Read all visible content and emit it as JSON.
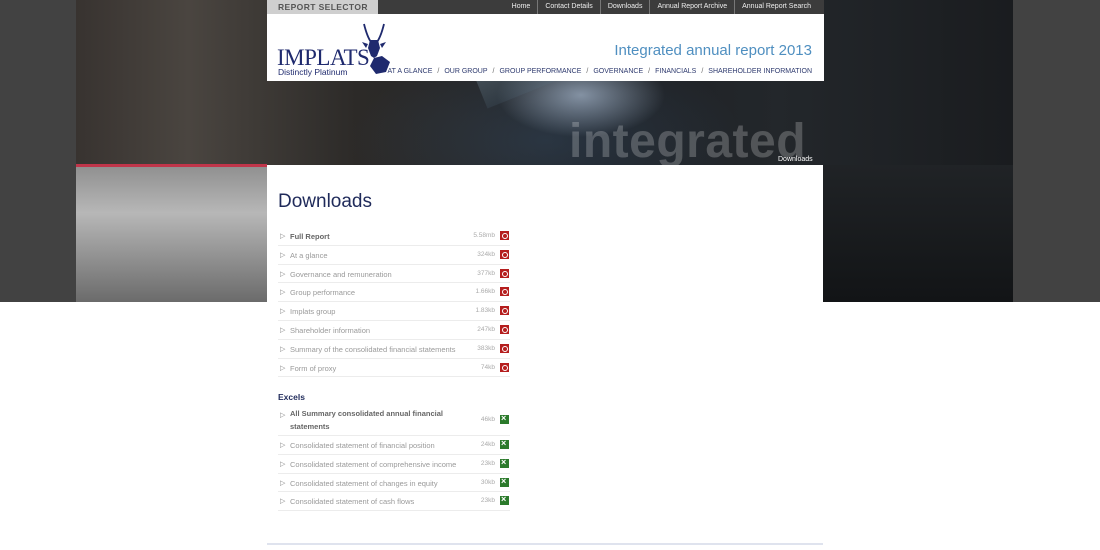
{
  "top_bar": {
    "report_selector": "REPORT SELECTOR",
    "links": [
      "Home",
      "Contact Details",
      "Downloads",
      "Annual Report Archive",
      "Annual Report Search"
    ]
  },
  "header": {
    "logo_word": "IMPLATS",
    "logo_tagline": "Distinctly Platinum",
    "site_title": "Integrated annual report 2013",
    "nav": [
      "AT A GLANCE",
      "OUR GROUP",
      "GROUP PERFORMANCE",
      "GOVERNANCE",
      "FINANCIALS",
      "SHAREHOLDER INFORMATION"
    ],
    "nav_separator": "/"
  },
  "hero": {
    "word": "integrated",
    "breadcrumb": "Downloads"
  },
  "page": {
    "title": "Downloads"
  },
  "pdf_downloads": [
    {
      "label": "Full Report",
      "size": "5.58mb",
      "icon": "pdf-icon",
      "bold": true
    },
    {
      "label": "At a glance",
      "size": "324kb",
      "icon": "pdf-icon",
      "bold": false
    },
    {
      "label": "Governance and remuneration",
      "size": "377kb",
      "icon": "pdf-icon",
      "bold": false
    },
    {
      "label": "Group performance",
      "size": "1.66kb",
      "icon": "pdf-icon",
      "bold": false
    },
    {
      "label": "Implats group",
      "size": "1.83kb",
      "icon": "pdf-icon",
      "bold": false
    },
    {
      "label": "Shareholder information",
      "size": "247kb",
      "icon": "pdf-icon",
      "bold": false
    },
    {
      "label": "Summary of the consolidated financial statements",
      "size": "383kb",
      "icon": "pdf-icon",
      "bold": false
    },
    {
      "label": "Form of proxy",
      "size": "74kb",
      "icon": "pdf-icon",
      "bold": false
    }
  ],
  "excels": {
    "heading": "Excels",
    "items": [
      {
        "label": "All Summary consolidated annual financial statements",
        "size": "46kb",
        "icon": "excel-icon",
        "bold": true
      },
      {
        "label": "Consolidated statement of financial position",
        "size": "24kb",
        "icon": "excel-icon",
        "bold": false
      },
      {
        "label": "Consolidated statement of comprehensive income",
        "size": "23kb",
        "icon": "excel-icon",
        "bold": false
      },
      {
        "label": "Consolidated statement of changes in equity",
        "size": "30kb",
        "icon": "excel-icon",
        "bold": false
      },
      {
        "label": "Consolidated statement of cash flows",
        "size": "23kb",
        "icon": "excel-icon",
        "bold": false
      }
    ]
  },
  "colors": {
    "brand_navy": "#1f2a6e",
    "title_blue": "#4f8fc0",
    "pdf_red": "#b51e1e",
    "excel_green": "#2b7a2b"
  }
}
